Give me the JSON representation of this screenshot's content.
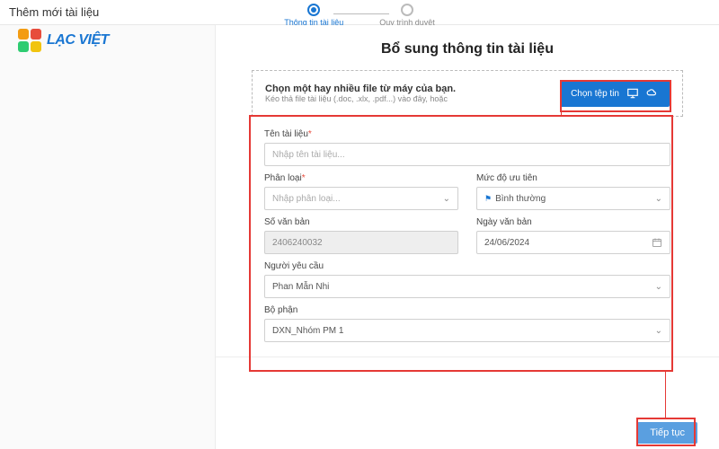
{
  "page": {
    "title": "Thêm mới tài liệu"
  },
  "logo": {
    "text": "Lạc Việt"
  },
  "steps": {
    "s1": "Thông tin tài liệu",
    "s2": "Quy trình duyệt"
  },
  "main": {
    "heading": "Bổ sung thông tin tài liệu",
    "upload": {
      "line1": "Chọn một hay nhiều file từ máy của bạn.",
      "line2": "Kéo thả file tài liệu (.doc, .xlx, .pdf...) vào đây, hoặc",
      "button": "Chọn tệp tin"
    },
    "fields": {
      "docname": {
        "label": "Tên tài liệu",
        "placeholder": "Nhập tên tài liệu..."
      },
      "category": {
        "label": "Phân loại",
        "placeholder": "Nhập phân loại..."
      },
      "priority": {
        "label": "Mức độ ưu tiên",
        "value": "Bình thường"
      },
      "docno": {
        "label": "Số văn bản",
        "value": "2406240032"
      },
      "docdate": {
        "label": "Ngày văn bản",
        "value": "24/06/2024"
      },
      "requester": {
        "label": "Người yêu cầu",
        "value": "Phan Mẫn Nhi"
      },
      "department": {
        "label": "Bộ phận",
        "value": "DXN_Nhóm PM 1"
      }
    },
    "continue": "Tiếp tục"
  }
}
